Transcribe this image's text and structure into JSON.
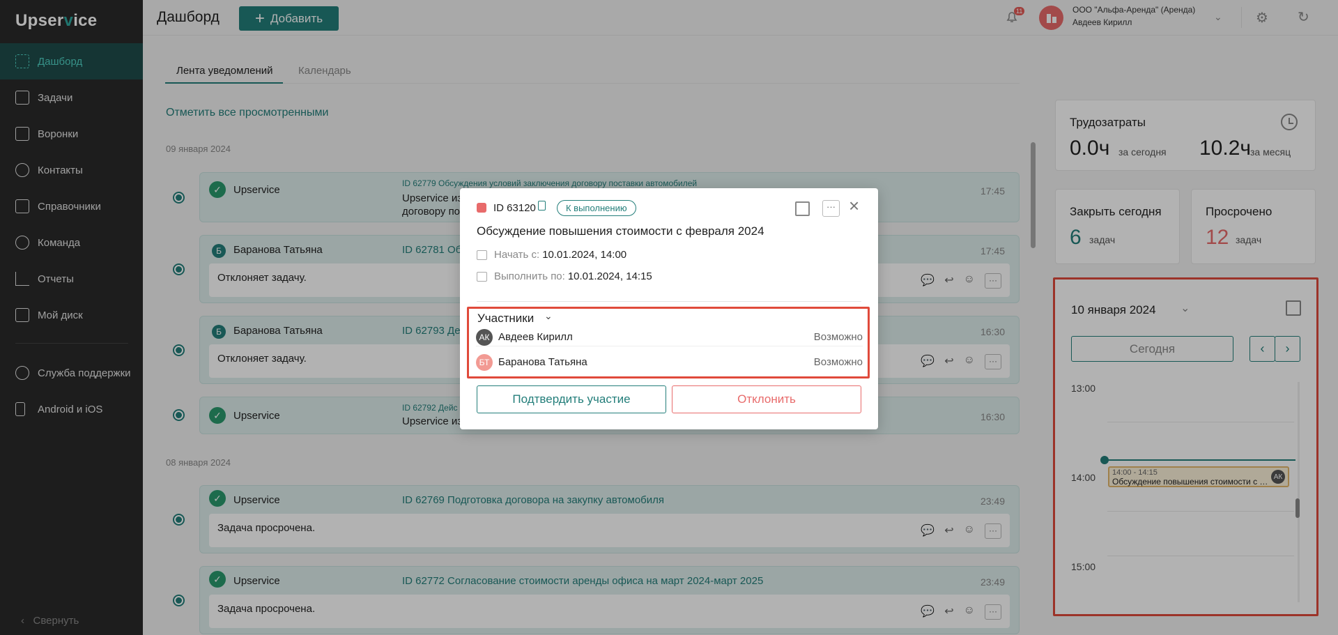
{
  "app": {
    "logo_a": "Upser",
    "logo_b": "v",
    "logo_c": "ice"
  },
  "sidebar": {
    "items": [
      {
        "label": "Дашборд",
        "icon": "dashboard-icon"
      },
      {
        "label": "Задачи",
        "icon": "tasks-icon"
      },
      {
        "label": "Воронки",
        "icon": "funnel-icon"
      },
      {
        "label": "Контакты",
        "icon": "contacts-icon"
      },
      {
        "label": "Справочники",
        "icon": "book-icon"
      },
      {
        "label": "Команда",
        "icon": "team-icon"
      },
      {
        "label": "Отчеты",
        "icon": "chart-icon"
      },
      {
        "label": "Мой диск",
        "icon": "folder-icon"
      },
      {
        "label": "Служба поддержки",
        "icon": "help-icon"
      },
      {
        "label": "Android и iOS",
        "icon": "phone-icon"
      }
    ],
    "collapse": "Свернуть"
  },
  "header": {
    "title": "Дашборд",
    "add_button": "Добавить",
    "notifications_count": "11",
    "org_initials": "",
    "org": "ООО \"Альфа-Аренда\" (Аренда)",
    "user": "Авдеев Кирилл"
  },
  "tabs": [
    "Лента уведомлений",
    "Календарь"
  ],
  "feed": {
    "mark_all": "Отметить все просмотренными",
    "dates": [
      "09 января 2024",
      "08 января 2024"
    ],
    "cards": [
      {
        "who": "Upservice",
        "task": "ID 62779 Обсуждения условий заключения договору поставки автомобилей",
        "sub": "Upservice из\nдоговору по",
        "time": "17:45"
      },
      {
        "who": "Баранова Татьяна",
        "initial": "Б",
        "task": "ID 62781 Обс",
        "text": "Отклоняет задачу.",
        "time": "17:45"
      },
      {
        "who": "Баранова Татьяна",
        "initial": "Б",
        "task": "ID 62793 Дей",
        "text": "Отклоняет задачу.",
        "time": "16:30"
      },
      {
        "who": "Upservice",
        "task": "ID 62792 Дейс",
        "sub": "Upservice из",
        "time": "16:30"
      },
      {
        "who": "Upservice",
        "task": "ID 62769 Подготовка договора на закупку автомобиля",
        "text": "Задача просрочена.",
        "time": "23:49"
      },
      {
        "who": "Upservice",
        "task": "ID 62772 Согласование стоимости аренды офиса на март 2024-март 2025",
        "text": "Задача просрочена.",
        "time": "23:49"
      }
    ]
  },
  "stats": {
    "labor_title": "Трудозатраты",
    "today_value": "0.0ч",
    "today_label": "за сегодня",
    "month_value": "10.2ч",
    "month_label": "за месяц",
    "close_title": "Закрыть сегодня",
    "close_value": "6",
    "close_unit": "задач",
    "overdue_title": "Просрочено",
    "overdue_value": "12",
    "overdue_unit": "задач"
  },
  "calendar": {
    "date": "10 января 2024",
    "today": "Сегодня",
    "hours": [
      "13:00",
      "14:00",
      "15:00"
    ],
    "event": {
      "time": "14:00 - 14:15",
      "title": "Обсуждение повышения стоимости с февраля 2024",
      "initials": "АК"
    }
  },
  "modal": {
    "id": "ID 63120",
    "status": "К выполнению",
    "title": "Обсуждение повышения стоимости с февраля 2024",
    "start_label": "Начать с:",
    "start_value": "10.01.2024, 14:00",
    "due_label": "Выполнить по:",
    "due_value": "10.01.2024, 14:15",
    "participants_label": "Участники",
    "participants": [
      {
        "initials": "АК",
        "name": "Авдеев Кирилл",
        "status": "Возможно",
        "color": "#555555"
      },
      {
        "initials": "БТ",
        "name": "Баранова Татьяна",
        "status": "Возможно",
        "color": "#f29a93"
      }
    ],
    "confirm": "Подтвердить участие",
    "decline": "Отклонить"
  },
  "colors": {
    "accent": "#237e7a",
    "danger": "#e86b6b",
    "highlight": "#e04a3b"
  }
}
